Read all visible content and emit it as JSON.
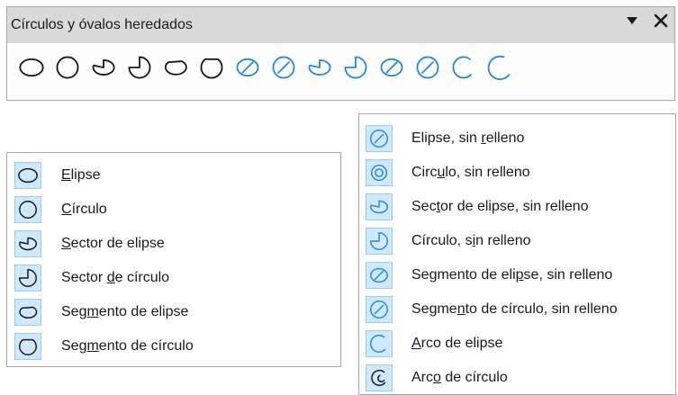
{
  "toolbar": {
    "title": "Círculos y óvalos heredados",
    "dropdown_icon": "triangle-down-icon",
    "close_icon": "close-icon",
    "icons": [
      {
        "name": "ellipse-icon",
        "kind": "ellipse",
        "color": "#1a1a1a"
      },
      {
        "name": "circle-icon",
        "kind": "circle",
        "color": "#1a1a1a"
      },
      {
        "name": "ellipse-pie-icon",
        "kind": "ellipsepie",
        "color": "#1a1a1a"
      },
      {
        "name": "circle-pie-icon",
        "kind": "circlepie",
        "color": "#1a1a1a"
      },
      {
        "name": "ellipse-segment-icon",
        "kind": "ellipseseg",
        "color": "#1a1a1a"
      },
      {
        "name": "circle-segment-icon",
        "kind": "circleseg",
        "color": "#1a1a1a"
      },
      {
        "name": "ellipse-unfilled-icon",
        "kind": "ellipseslash",
        "color": "#2a8ad8"
      },
      {
        "name": "circle-unfilled-icon",
        "kind": "circleslash",
        "color": "#2a8ad8"
      },
      {
        "name": "ellipse-pie-unfilled-icon",
        "kind": "ellipsepie",
        "color": "#2a8ad8"
      },
      {
        "name": "circle-pie-unfilled-icon",
        "kind": "circlepie",
        "color": "#2a8ad8"
      },
      {
        "name": "ellipse-segment-unfilled-icon",
        "kind": "ellipseslash",
        "color": "#2a8ad8"
      },
      {
        "name": "circle-segment-unfilled-icon",
        "kind": "circleslash",
        "color": "#2a8ad8"
      },
      {
        "name": "ellipse-arc-icon",
        "kind": "arc",
        "color": "#2a8ad8"
      },
      {
        "name": "circle-arc-icon",
        "kind": "arc2",
        "color": "#2a8ad8"
      }
    ]
  },
  "menu_filled": {
    "items": [
      {
        "name": "menu-item-elipse",
        "icon": "ellipse-icon",
        "kind": "ellipse",
        "color": "#1a1a1a",
        "pre": "",
        "u": "E",
        "post": "lipse"
      },
      {
        "name": "menu-item-circulo",
        "icon": "circle-icon",
        "kind": "circle",
        "color": "#1a1a1a",
        "pre": "",
        "u": "C",
        "post": "írculo"
      },
      {
        "name": "menu-item-sector-elipse",
        "icon": "ellipse-pie-icon",
        "kind": "ellipsepie",
        "color": "#1a1a1a",
        "pre": "",
        "u": "S",
        "post": "ector de elipse"
      },
      {
        "name": "menu-item-sector-circulo",
        "icon": "circle-pie-icon",
        "kind": "circlepie",
        "color": "#1a1a1a",
        "pre": "Sector ",
        "u": "d",
        "post": "e círculo"
      },
      {
        "name": "menu-item-segmento-elipse",
        "icon": "ellipse-segment-icon",
        "kind": "ellipseseg",
        "color": "#1a1a1a",
        "pre": "Seg",
        "u": "m",
        "post": "ento de elipse"
      },
      {
        "name": "menu-item-segmento-circulo",
        "icon": "circle-segment-icon",
        "kind": "circleseg",
        "color": "#1a1a1a",
        "pre": "Seg",
        "u": "m",
        "post": "ento de círculo"
      }
    ]
  },
  "menu_unfilled": {
    "items": [
      {
        "name": "menu-item-elipse-sin-relleno",
        "icon": "ellipse-unfilled-icon",
        "kind": "circleslash",
        "color": "#2a8ad8",
        "pre": "Elipse, sin ",
        "u": "r",
        "post": "elleno"
      },
      {
        "name": "menu-item-circulo-sin-relleno",
        "icon": "circle-unfilled-icon",
        "kind": "concentric",
        "color": "#2a8ad8",
        "pre": "Circ",
        "u": "u",
        "post": "lo, sin relleno"
      },
      {
        "name": "menu-item-sector-elipse-sin-relleno",
        "icon": "ellipse-pie-unfilled-icon",
        "kind": "ellipsepie",
        "color": "#2a8ad8",
        "pre": "Sec",
        "u": "t",
        "post": "or de elipse, sin relleno"
      },
      {
        "name": "menu-item-circulo-pie-sin-relleno",
        "icon": "circle-pie-unfilled-icon",
        "kind": "circlepie",
        "color": "#2a8ad8",
        "pre": "Círculo, s",
        "u": "i",
        "post": "n relleno"
      },
      {
        "name": "menu-item-segmento-elipse-sin-relleno",
        "icon": "ellipse-segment-unfilled-icon",
        "kind": "ellipseslash",
        "color": "#2a8ad8",
        "pre": "Segmento de eli",
        "u": "p",
        "post": "se, sin relleno"
      },
      {
        "name": "menu-item-segmento-circulo-sin-relleno",
        "icon": "circle-segment-unfilled-icon",
        "kind": "circleslash",
        "color": "#2a8ad8",
        "pre": "Segme",
        "u": "n",
        "post": "to de círculo, sin relleno"
      },
      {
        "name": "menu-item-arco-elipse",
        "icon": "ellipse-arc-icon",
        "kind": "arc",
        "color": "#2a8ad8",
        "pre": "",
        "u": "A",
        "post": "rco de elipse"
      },
      {
        "name": "menu-item-arco-circulo",
        "icon": "circle-arc-icon",
        "kind": "arccircle",
        "color": "#1a1a1a",
        "pre": "Arc",
        "u": "o",
        "post": " de círculo"
      }
    ]
  }
}
